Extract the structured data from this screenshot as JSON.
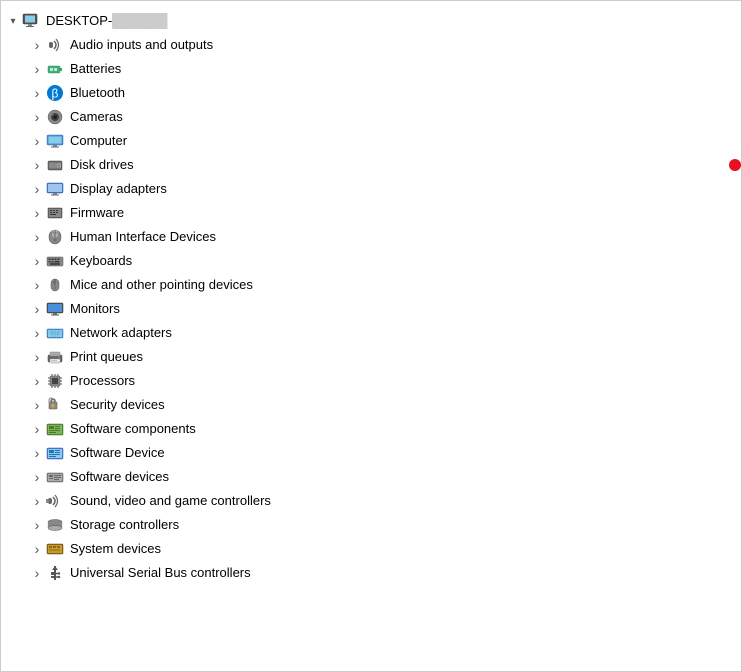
{
  "tree": {
    "root": {
      "label": "DESKTOP-",
      "labelSuffix": "██████",
      "expanded": true
    },
    "items": [
      {
        "id": "audio",
        "label": "Audio inputs and outputs",
        "icon": "audio",
        "hasDot": false
      },
      {
        "id": "batteries",
        "label": "Batteries",
        "icon": "batteries",
        "hasDot": false
      },
      {
        "id": "bluetooth",
        "label": "Bluetooth",
        "icon": "bluetooth",
        "hasDot": false
      },
      {
        "id": "cameras",
        "label": "Cameras",
        "icon": "cameras",
        "hasDot": false
      },
      {
        "id": "computer",
        "label": "Computer",
        "icon": "computer",
        "hasDot": false
      },
      {
        "id": "diskdrives",
        "label": "Disk drives",
        "icon": "diskdrives",
        "hasDot": true
      },
      {
        "id": "displayadapters",
        "label": "Display adapters",
        "icon": "displayadapters",
        "hasDot": false
      },
      {
        "id": "firmware",
        "label": "Firmware",
        "icon": "firmware",
        "hasDot": false
      },
      {
        "id": "hid",
        "label": "Human Interface Devices",
        "icon": "hid",
        "hasDot": false
      },
      {
        "id": "keyboards",
        "label": "Keyboards",
        "icon": "keyboards",
        "hasDot": false
      },
      {
        "id": "mice",
        "label": "Mice and other pointing devices",
        "icon": "mice",
        "hasDot": false
      },
      {
        "id": "monitors",
        "label": "Monitors",
        "icon": "monitors",
        "hasDot": false
      },
      {
        "id": "network",
        "label": "Network adapters",
        "icon": "network",
        "hasDot": false
      },
      {
        "id": "print",
        "label": "Print queues",
        "icon": "print",
        "hasDot": false
      },
      {
        "id": "processors",
        "label": "Processors",
        "icon": "processors",
        "hasDot": false
      },
      {
        "id": "security",
        "label": "Security devices",
        "icon": "security",
        "hasDot": false
      },
      {
        "id": "softwarecomponents",
        "label": "Software components",
        "icon": "softwarecomponents",
        "hasDot": false
      },
      {
        "id": "softwaredevice",
        "label": "Software Device",
        "icon": "softwaredevice",
        "hasDot": false
      },
      {
        "id": "softwaredevices",
        "label": "Software devices",
        "icon": "softwaredevices",
        "hasDot": false
      },
      {
        "id": "sound",
        "label": "Sound, video and game controllers",
        "icon": "sound",
        "hasDot": false
      },
      {
        "id": "storage",
        "label": "Storage controllers",
        "icon": "storage",
        "hasDot": false
      },
      {
        "id": "system",
        "label": "System devices",
        "icon": "system",
        "hasDot": false
      },
      {
        "id": "usb",
        "label": "Universal Serial Bus controllers",
        "icon": "usb",
        "hasDot": false
      }
    ]
  }
}
